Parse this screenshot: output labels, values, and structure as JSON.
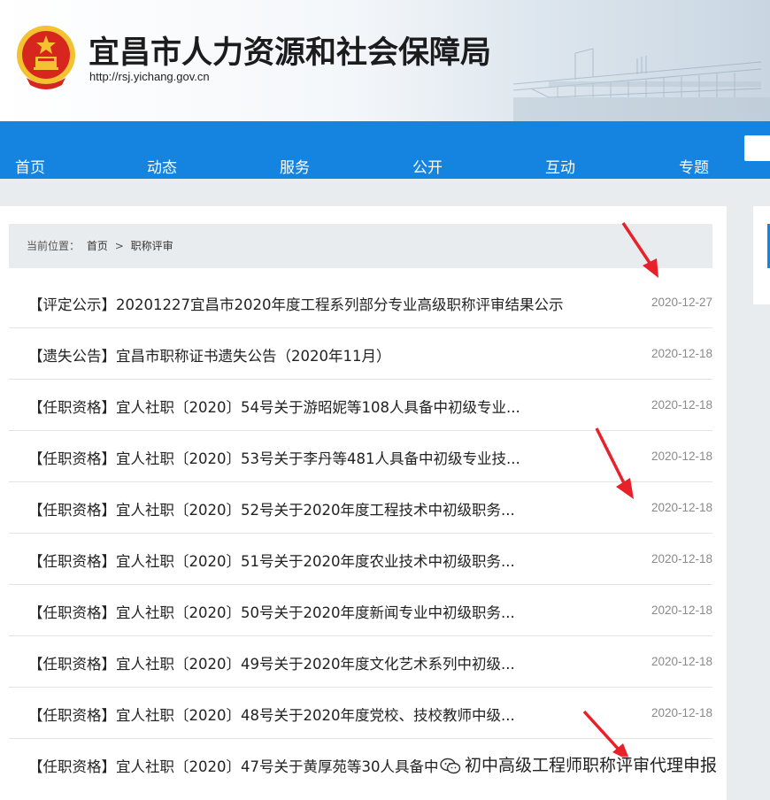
{
  "header": {
    "site_title": "宜昌市人力资源和社会保障局",
    "site_url": "http://rsj.yichang.gov.cn"
  },
  "nav": {
    "items": [
      "首页",
      "动态",
      "服务",
      "公开",
      "互动",
      "专题"
    ]
  },
  "breadcrumb": {
    "prefix": "当前位置：",
    "home": "首页",
    "separator": ">",
    "current": "职称评审"
  },
  "news": [
    {
      "title": "【评定公示】20201227宜昌市2020年度工程系列部分专业高级职称评审结果公示",
      "date": "2020-12-27"
    },
    {
      "title": "【遗失公告】宜昌市职称证书遗失公告（2020年11月）",
      "date": "2020-12-18"
    },
    {
      "title": "【任职资格】宜人社职〔2020〕54号关于游昭妮等108人具备中初级专业...",
      "date": "2020-12-18"
    },
    {
      "title": "【任职资格】宜人社职〔2020〕53号关于李丹等481人具备中初级专业技...",
      "date": "2020-12-18"
    },
    {
      "title": "【任职资格】宜人社职〔2020〕52号关于2020年度工程技术中初级职务...",
      "date": "2020-12-18"
    },
    {
      "title": "【任职资格】宜人社职〔2020〕51号关于2020年度农业技术中初级职务...",
      "date": "2020-12-18"
    },
    {
      "title": "【任职资格】宜人社职〔2020〕50号关于2020年度新闻专业中初级职务...",
      "date": "2020-12-18"
    },
    {
      "title": "【任职资格】宜人社职〔2020〕49号关于2020年度文化艺术系列中初级...",
      "date": "2020-12-18"
    },
    {
      "title": "【任职资格】宜人社职〔2020〕48号关于2020年度党校、技校教师中级...",
      "date": "2020-12-18"
    },
    {
      "title": "【任职资格】宜人社职〔2020〕47号关于黄厚苑等30人具备中",
      "date": ""
    }
  ],
  "watermark": {
    "text": "初中高级工程师职称评审代理申报",
    "icon": "wechat-icon"
  },
  "colors": {
    "nav_blue": "#1583e0",
    "arrow_red": "#e8202a",
    "emblem_red": "#d7261e",
    "emblem_gold": "#f2c230"
  }
}
